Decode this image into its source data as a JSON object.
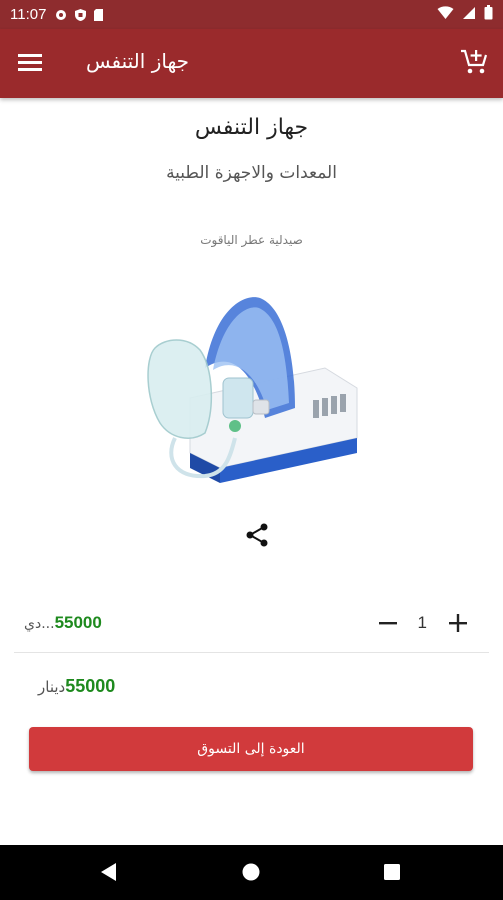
{
  "status_bar": {
    "time": "11:07",
    "icons_left": [
      "settings-icon",
      "shield-icon",
      "sd-card-icon"
    ],
    "icons_right": [
      "wifi-icon",
      "signal-icon",
      "battery-icon"
    ]
  },
  "app_bar": {
    "title": "جهاز التنفس",
    "menu_icon": "menu-icon",
    "cart_icon": "add-to-cart-icon"
  },
  "product": {
    "title": "جهاز التنفس",
    "category": "المعدات والاجهزة الطبية",
    "store": "صيدلية عطر الياقوت",
    "image_icon": "nebulizer-image"
  },
  "share": {
    "icon": "share-icon"
  },
  "price_row": {
    "price": "55000",
    "currency": "دي...",
    "quantity": "1"
  },
  "total": {
    "price": "55000",
    "currency": "دينار"
  },
  "back_button": {
    "label": "العودة إلى التسوق"
  },
  "colors": {
    "status_bar": "#8e2c2e",
    "app_bar": "#9a2a2c",
    "accent_button": "#d13a3c",
    "price_green": "#1e8a1e"
  },
  "nav_bar": {
    "icons": [
      "back-icon",
      "home-icon",
      "recents-icon"
    ]
  }
}
